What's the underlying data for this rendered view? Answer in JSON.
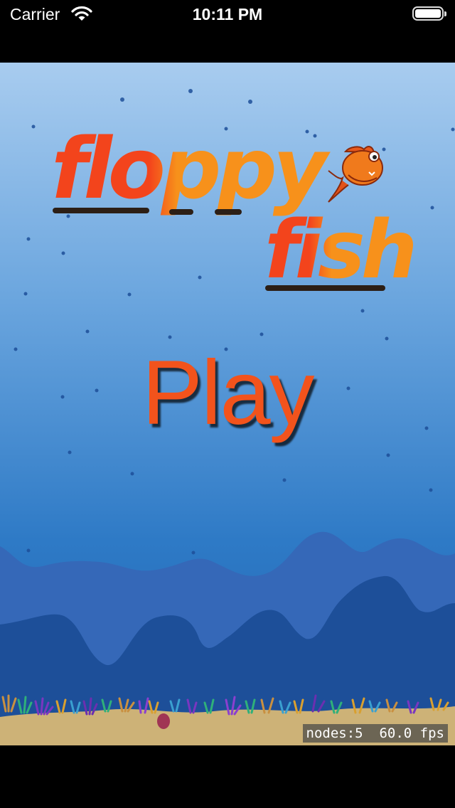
{
  "status_bar": {
    "carrier": "Carrier",
    "time": "10:11 PM",
    "wifi_icon": "wifi-icon",
    "battery_icon": "battery-full-icon"
  },
  "game": {
    "logo": {
      "word1": "floppy",
      "word2": "fish",
      "mascot": "orange-fish-icon"
    },
    "play_label": "Play",
    "debug": {
      "nodes": "nodes:5",
      "fps": "60.0 fps"
    }
  },
  "colors": {
    "sky_top": "#a8ccef",
    "sky_bottom": "#2a78c4",
    "back_reef": "#3568b8",
    "front_reef": "#1d4f99",
    "sand": "#cdb277",
    "play_text": "#f2531c",
    "logo_red": "#f3441c",
    "logo_orange": "#f7911b"
  }
}
